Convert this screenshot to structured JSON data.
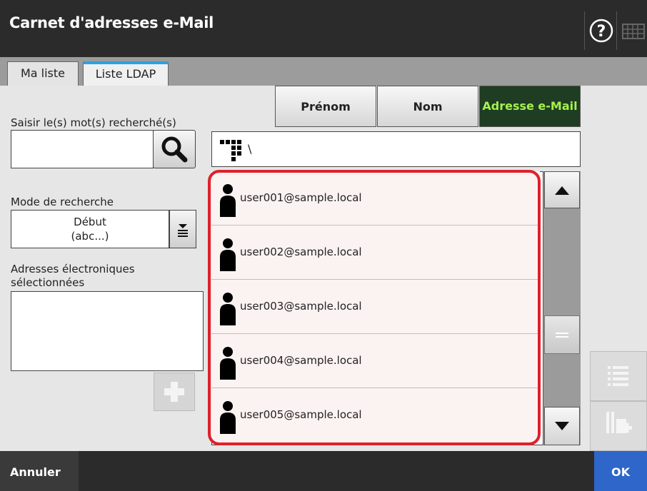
{
  "header": {
    "title": "Carnet d'adresses e-Mail",
    "help_icon": "help-circle-icon",
    "keyboard_icon": "keyboard-icon"
  },
  "tabs": [
    {
      "label": "Ma liste",
      "active": false
    },
    {
      "label": "Liste LDAP",
      "active": true
    }
  ],
  "search": {
    "label": "Saisir le(s) mot(s) recherché(s)",
    "value": "",
    "button_icon": "search-icon"
  },
  "mode": {
    "label": "Mode de recherche",
    "value_line1": "Début",
    "value_line2": "(abc...)"
  },
  "selected": {
    "label_line1": "Adresses électroniques",
    "label_line2": "sélectionnées",
    "add_icon": "plus-icon"
  },
  "columns": {
    "first": "Prénom",
    "second": "Nom",
    "third": "Adresse e-Mail"
  },
  "path": {
    "text": "\\",
    "icon": "tree-icon"
  },
  "entries": [
    {
      "email": "user001@sample.local"
    },
    {
      "email": "user002@sample.local"
    },
    {
      "email": "user003@sample.local"
    },
    {
      "email": "user004@sample.local"
    },
    {
      "email": "user005@sample.local"
    }
  ],
  "footer": {
    "cancel": "Annuler",
    "ok": "OK"
  },
  "colors": {
    "accent_tab": "#2ba3e0",
    "selected_column_bg": "#1f3d23",
    "selected_column_text": "#a7f04e",
    "highlight": "#e0202a",
    "ok": "#2f66c9"
  }
}
